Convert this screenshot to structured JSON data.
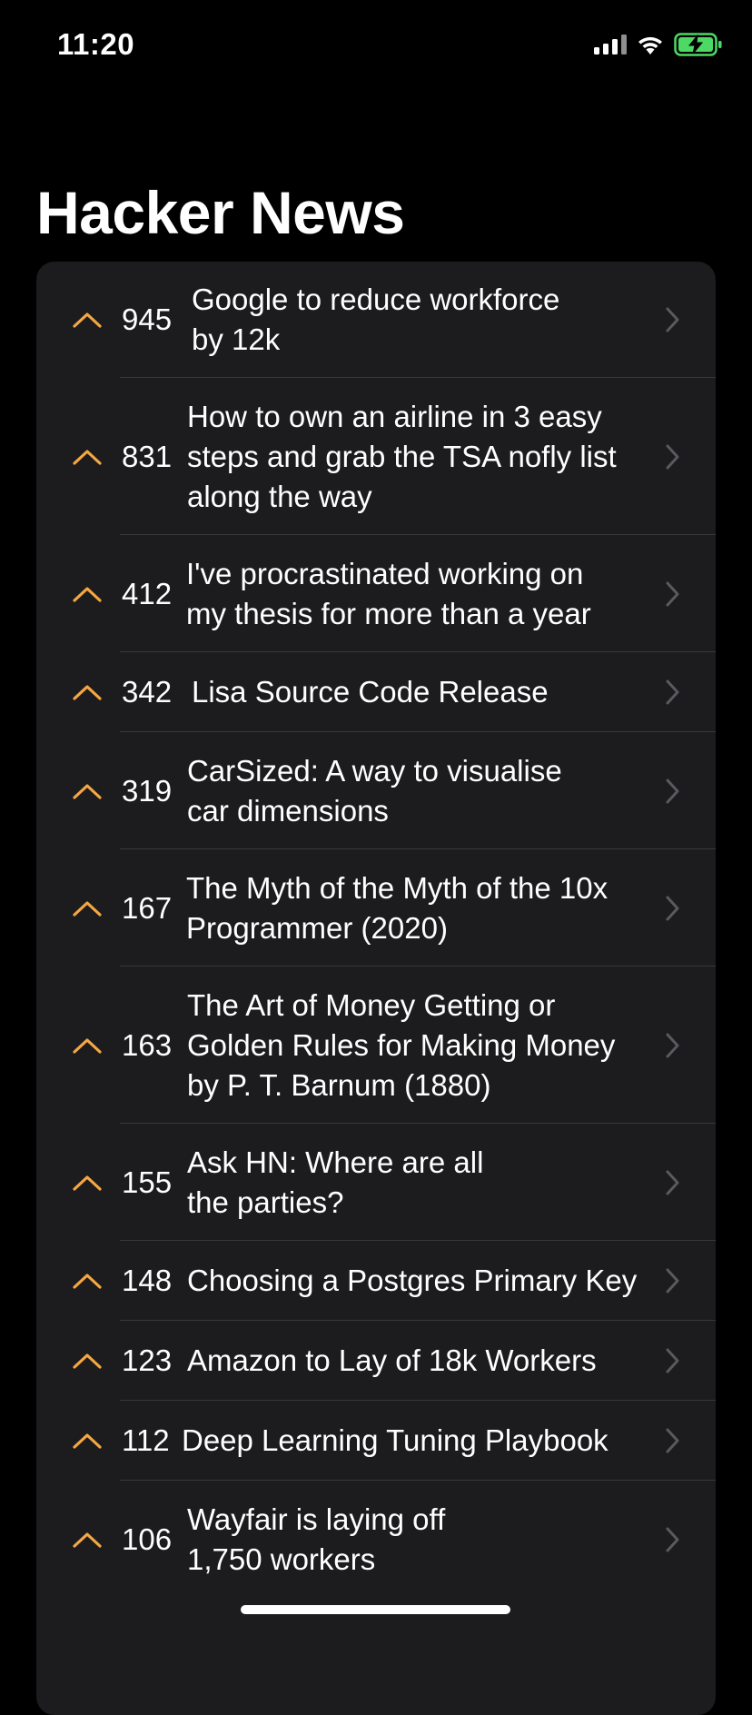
{
  "status_bar": {
    "time": "11:20",
    "icons": [
      "cellular-signal-icon",
      "wifi-icon",
      "battery-charging-icon"
    ]
  },
  "page": {
    "title": "Hacker News"
  },
  "colors": {
    "background": "#000000",
    "card": "#1c1c1e",
    "accent": "#f5a742",
    "separator": "#38383a",
    "chevron": "#5a5a5e"
  },
  "stories": [
    {
      "score": "945",
      "title": "Google to reduce workforce\nby 12k"
    },
    {
      "score": "831",
      "title": "How to own an airline in 3 easy\nsteps and grab the TSA nofly list\nalong the way"
    },
    {
      "score": "412",
      "title": "I've procrastinated working on\nmy thesis for more than a year"
    },
    {
      "score": "342",
      "title": "Lisa Source Code Release"
    },
    {
      "score": "319",
      "title": "CarSized: A way to visualise\ncar dimensions"
    },
    {
      "score": "167",
      "title": "The Myth of the Myth of the 10x\nProgrammer (2020)"
    },
    {
      "score": "163",
      "title": "The Art of Money Getting or\nGolden Rules for Making Money\nby P. T. Barnum (1880)"
    },
    {
      "score": "155",
      "title": "Ask HN: Where are all\nthe parties?"
    },
    {
      "score": "148",
      "title": "Choosing a Postgres Primary Key"
    },
    {
      "score": "123",
      "title": "Amazon to Lay of 18k Workers"
    },
    {
      "score": "112",
      "title": "Deep Learning Tuning Playbook"
    },
    {
      "score": "106",
      "title": "Wayfair is laying off\n1,750 workers"
    }
  ]
}
